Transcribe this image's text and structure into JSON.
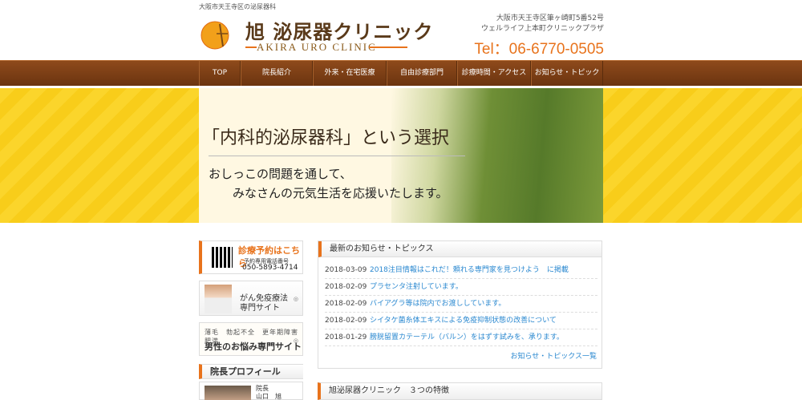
{
  "header": {
    "tagline": "大阪市天王寺区の泌尿器科",
    "logo_jp": "旭 泌尿器クリニック",
    "logo_en": "AKIRA URO CLINIC",
    "logo_mark_text": "AKIRA URO CLINIC",
    "address_line1": "大阪市天王寺区筆ヶ崎町5番52号",
    "address_line2": "ウェルライフ上本町クリニックプラザ",
    "tel": "Tel：06-6770-0505"
  },
  "nav": {
    "items": [
      {
        "label": "TOP"
      },
      {
        "label": "院長紹介"
      },
      {
        "label": "外来・在宅医療"
      },
      {
        "label": "自由診療部門"
      },
      {
        "label": "診療時間・アクセス"
      },
      {
        "label": "お知らせ・トピックス"
      }
    ]
  },
  "hero": {
    "title": "「内科的泌尿器科」という選択",
    "sub1": "おしっこの問題を通して、",
    "sub2": "みなさんの元気生活を応援いたします。"
  },
  "sidebar": {
    "reservation": {
      "title": "診療予約はこちら",
      "sub": "予約専用電話番号",
      "number": "050-5893-4714"
    },
    "gan": {
      "line1": "がん免疫療法",
      "line2": "専門サイト"
    },
    "men": {
      "line1": "薄毛　勃起不全　更年期障害　肥満",
      "line2": "男性のお悩み専門サイト"
    },
    "profile": {
      "heading": "院長プロフィール",
      "role": "院長",
      "name": "山口　旭"
    }
  },
  "news": {
    "heading": "最新のお知らせ・トピックス",
    "items": [
      {
        "date": "2018-03-09",
        "title": "2018注目情報はこれだ！頼れる専門家を見つけよう　に掲載"
      },
      {
        "date": "2018-02-09",
        "title": "プラセンタ注射しています。"
      },
      {
        "date": "2018-02-09",
        "title": "バイアグラ等は院内でお渡ししています。"
      },
      {
        "date": "2018-02-09",
        "title": "シイタケ菌糸体エキスによる免疫抑制状態の改善について"
      },
      {
        "date": "2018-01-29",
        "title": "膀胱留置カテーテル（バルン）をはずす試みを、承ります。"
      }
    ],
    "more": "お知らせ・トピックス一覧"
  },
  "features": {
    "heading": "旭泌尿器クリニック　３つの特徴"
  },
  "colors": {
    "accent": "#e8731c",
    "nav": "#7a3c14",
    "link": "#2a88d0",
    "hero_bg": "#fbd52b"
  }
}
